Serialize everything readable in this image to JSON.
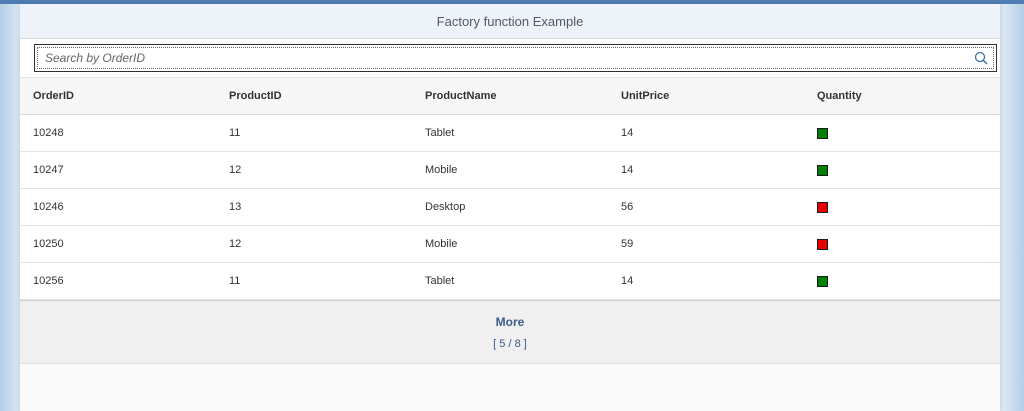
{
  "page": {
    "title": "Factory function Example"
  },
  "search": {
    "placeholder": "Search by OrderID",
    "value": ""
  },
  "table": {
    "columns": [
      "OrderID",
      "ProductID",
      "ProductName",
      "UnitPrice",
      "Quantity"
    ],
    "rows": [
      {
        "order_id": "10248",
        "product_id": "11",
        "product_name": "Tablet",
        "unit_price": "14",
        "quantity_status": "ok",
        "quantity_color": "#008000"
      },
      {
        "order_id": "10247",
        "product_id": "12",
        "product_name": "Mobile",
        "unit_price": "14",
        "quantity_status": "ok",
        "quantity_color": "#008000"
      },
      {
        "order_id": "10246",
        "product_id": "13",
        "product_name": "Desktop",
        "unit_price": "56",
        "quantity_status": "low",
        "quantity_color": "#e60000"
      },
      {
        "order_id": "10250",
        "product_id": "12",
        "product_name": "Mobile",
        "unit_price": "59",
        "quantity_status": "low",
        "quantity_color": "#e60000"
      },
      {
        "order_id": "10256",
        "product_id": "11",
        "product_name": "Tablet",
        "unit_price": "14",
        "quantity_status": "ok",
        "quantity_color": "#008000"
      }
    ]
  },
  "more": {
    "label": "More",
    "count": "[ 5 / 8 ]"
  },
  "colors": {
    "accent": "#3c5c8a",
    "header_bar": "#4f7db3",
    "ok": "#008000",
    "low": "#e60000"
  }
}
